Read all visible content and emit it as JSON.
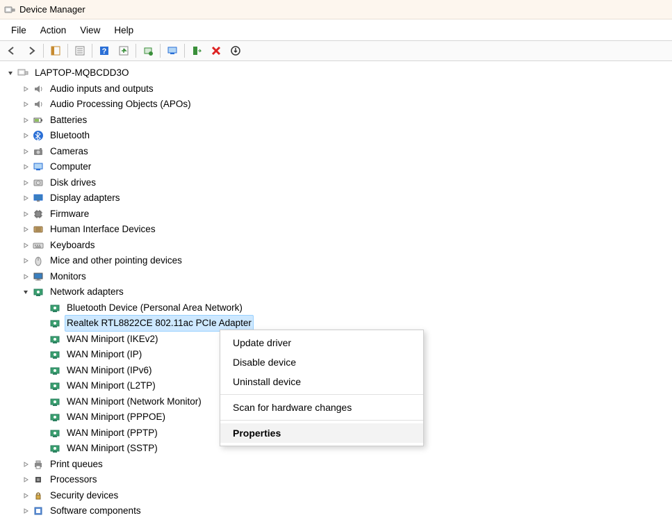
{
  "window": {
    "title": "Device Manager"
  },
  "menubar": {
    "file": "File",
    "action": "Action",
    "view": "View",
    "help": "Help"
  },
  "root": {
    "name": "LAPTOP-MQBCDD3O"
  },
  "categories": [
    {
      "label": "Audio inputs and outputs",
      "icon": "speaker",
      "state": "collapsed"
    },
    {
      "label": "Audio Processing Objects (APOs)",
      "icon": "speaker",
      "state": "collapsed"
    },
    {
      "label": "Batteries",
      "icon": "battery",
      "state": "collapsed"
    },
    {
      "label": "Bluetooth",
      "icon": "bluetooth",
      "state": "collapsed"
    },
    {
      "label": "Cameras",
      "icon": "camera",
      "state": "collapsed"
    },
    {
      "label": "Computer",
      "icon": "computer",
      "state": "collapsed"
    },
    {
      "label": "Disk drives",
      "icon": "drive",
      "state": "collapsed"
    },
    {
      "label": "Display adapters",
      "icon": "display",
      "state": "collapsed"
    },
    {
      "label": "Firmware",
      "icon": "chip",
      "state": "collapsed"
    },
    {
      "label": "Human Interface Devices",
      "icon": "hid",
      "state": "collapsed"
    },
    {
      "label": "Keyboards",
      "icon": "keyboard",
      "state": "collapsed"
    },
    {
      "label": "Mice and other pointing devices",
      "icon": "mouse",
      "state": "collapsed"
    },
    {
      "label": "Monitors",
      "icon": "monitor",
      "state": "collapsed"
    },
    {
      "label": "Network adapters",
      "icon": "network",
      "state": "expanded",
      "children": [
        {
          "label": "Bluetooth Device (Personal Area Network)",
          "icon": "network"
        },
        {
          "label": "Realtek RTL8822CE 802.11ac PCIe Adapter",
          "icon": "network",
          "selected": true
        },
        {
          "label": "WAN Miniport (IKEv2)",
          "icon": "network"
        },
        {
          "label": "WAN Miniport (IP)",
          "icon": "network"
        },
        {
          "label": "WAN Miniport (IPv6)",
          "icon": "network"
        },
        {
          "label": "WAN Miniport (L2TP)",
          "icon": "network"
        },
        {
          "label": "WAN Miniport (Network Monitor)",
          "icon": "network"
        },
        {
          "label": "WAN Miniport (PPPOE)",
          "icon": "network"
        },
        {
          "label": "WAN Miniport (PPTP)",
          "icon": "network"
        },
        {
          "label": "WAN Miniport (SSTP)",
          "icon": "network"
        }
      ]
    },
    {
      "label": "Print queues",
      "icon": "printer",
      "state": "collapsed"
    },
    {
      "label": "Processors",
      "icon": "cpu",
      "state": "collapsed"
    },
    {
      "label": "Security devices",
      "icon": "security",
      "state": "collapsed"
    },
    {
      "label": "Software components",
      "icon": "software",
      "state": "collapsed"
    }
  ],
  "context_menu": {
    "items": [
      {
        "label": "Update driver",
        "type": "item"
      },
      {
        "label": "Disable device",
        "type": "item"
      },
      {
        "label": "Uninstall device",
        "type": "item"
      },
      {
        "type": "sep"
      },
      {
        "label": "Scan for hardware changes",
        "type": "item"
      },
      {
        "type": "sep"
      },
      {
        "label": "Properties",
        "type": "item",
        "bold": true
      }
    ]
  },
  "toolbar_icons": [
    "back",
    "forward",
    "sep",
    "show-hide",
    "sep",
    "properties",
    "sep",
    "help",
    "action",
    "sep",
    "update",
    "sep",
    "scan",
    "sep",
    "enable",
    "disable",
    "uninstall"
  ]
}
